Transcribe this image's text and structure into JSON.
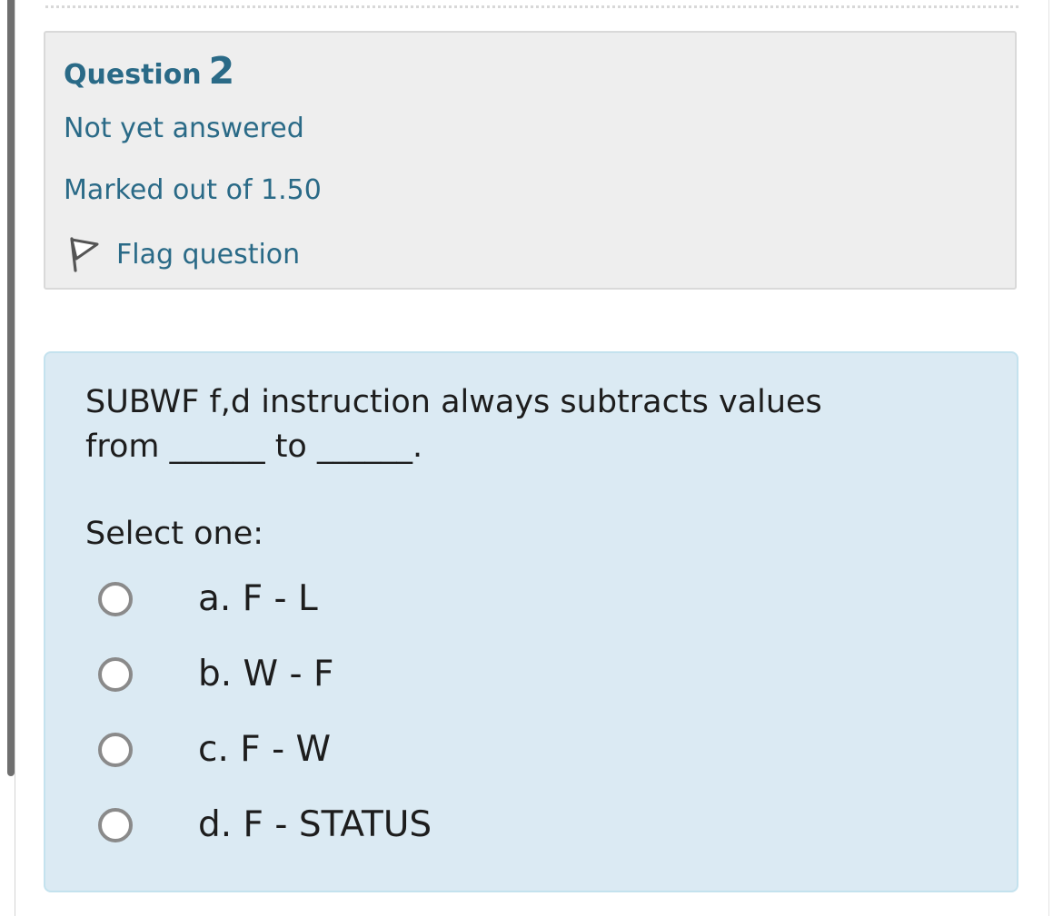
{
  "question_info": {
    "label": "Question",
    "number": "2",
    "state": "Not yet answered",
    "grade": "Marked out of 1.50",
    "flag_label": "Flag question"
  },
  "question": {
    "text": "SUBWF f,d instruction always subtracts values from ______ to ______.",
    "prompt": "Select one:",
    "options": [
      {
        "label": "a. F - L",
        "selected": false
      },
      {
        "label": "b. W - F",
        "selected": false
      },
      {
        "label": "c. F - W",
        "selected": false
      },
      {
        "label": "d. F - STATUS",
        "selected": false
      }
    ]
  },
  "colors": {
    "accent": "#2a6a87",
    "info_background": "#eeeeee",
    "content_background": "#dbeaf3",
    "text": "#1d1d1d"
  },
  "icons": {
    "flag": "flag-icon",
    "radio": "radio-button"
  }
}
